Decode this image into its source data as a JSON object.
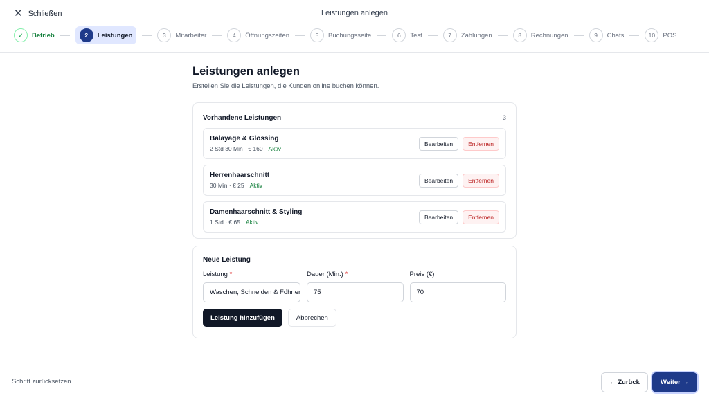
{
  "header": {
    "close_label": "Schließen",
    "close_icon": "close-icon",
    "title": "Leistungen anlegen"
  },
  "steps": [
    {
      "num": "✓",
      "label": "Betrieb",
      "state": "done"
    },
    {
      "num": "2",
      "label": "Leistungen",
      "state": "active"
    },
    {
      "num": "3",
      "label": "Mitarbeiter",
      "state": "todo"
    },
    {
      "num": "4",
      "label": "Öffnungszeiten",
      "state": "todo"
    },
    {
      "num": "5",
      "label": "Buchungsseite",
      "state": "todo"
    },
    {
      "num": "6",
      "label": "Test",
      "state": "todo"
    },
    {
      "num": "7",
      "label": "Zahlungen",
      "state": "todo"
    },
    {
      "num": "8",
      "label": "Rechnungen",
      "state": "todo"
    },
    {
      "num": "9",
      "label": "Chats",
      "state": "todo"
    },
    {
      "num": "10",
      "label": "POS",
      "state": "todo"
    }
  ],
  "main": {
    "title": "Leistungen anlegen",
    "subtitle": "Erstellen Sie die Leistungen, die Kunden online buchen können."
  },
  "existing": {
    "title": "Vorhandene Leistungen",
    "count": "3",
    "edit_label": "Bearbeiten",
    "remove_label": "Entfernen",
    "items": [
      {
        "name": "Balayage & Glossing",
        "meta": "2 Std 30 Min · € 160",
        "status": "Aktiv"
      },
      {
        "name": "Herrenhaarschnitt",
        "meta": "30 Min · € 25",
        "status": "Aktiv"
      },
      {
        "name": "Damenhaarschnitt & Styling",
        "meta": "1 Std · € 65",
        "status": "Aktiv"
      }
    ]
  },
  "new_service": {
    "title": "Neue Leistung",
    "service_label": "Leistung",
    "service_value": "Waschen, Schneiden & Föhnen",
    "duration_label": "Dauer (Min.)",
    "duration_value": "75",
    "price_label": "Preis (€)",
    "price_value": "70",
    "required_mark": "*",
    "add_label": "Leistung hinzufügen",
    "cancel_label": "Abbrechen"
  },
  "footer": {
    "reset_label": "Schritt zurücksetzen",
    "back_label": "← Zurück",
    "next_label": "Weiter →"
  },
  "colors": {
    "primary": "#1e3a8a",
    "success": "#15803d",
    "danger": "#b91c1c"
  }
}
